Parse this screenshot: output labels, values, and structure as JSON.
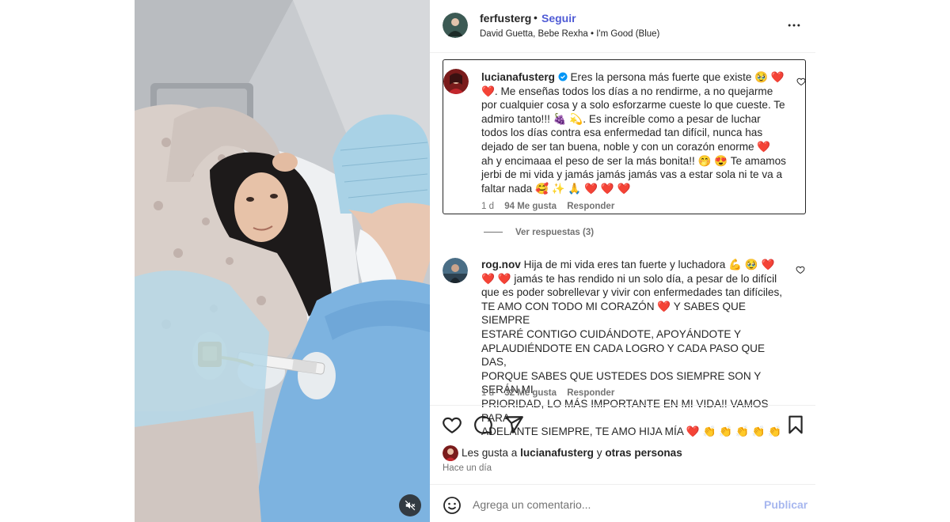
{
  "post": {
    "username": "ferfusterg",
    "follow_label": "Seguir",
    "separator": "•",
    "song": "David Guetta, Bebe Rexha • I'm Good (Blue)",
    "more_icon": "more-horizontal-icon",
    "mute_icon": "volume-muted-icon"
  },
  "comments": [
    {
      "username": "lucianafusterg",
      "verified": true,
      "text": "Eres la persona más fuerte que existe 🥹 ❤️\n❤️. Me enseñas todos los días a no rendirme, a no quejarme\npor cualquier cosa y a solo esforzarme cueste lo que cueste. Te\nadmiro tanto!!! 🍇 💫. Es increíble como a pesar de luchar\ntodos los días contra esa enfermedad tan difícil, nunca has\ndejado de ser tan buena, noble y con un corazón enorme ❤️\nah y encimaaa el peso de ser la más bonita!! 🤭 😍 Te amamos\njerbi de mi vida y jamás jamás jamás vas a estar sola ni te va a\nfaltar nada 🥰 ✨ 🙏 ❤️ ❤️ ❤️",
      "time": "1 d",
      "likes": "94 Me gusta",
      "reply_label": "Responder"
    },
    {
      "username": "rog.nov",
      "verified": false,
      "text": "Hija de mi vida eres tan fuerte y luchadora 💪 🥹 ❤️\n❤️ ❤️ jamás te has rendido ni un solo día, a pesar de lo difícil\nque es poder sobrellevar y vivir con enfermedades tan difíciles,\nTE AMO CON TODO MI CORAZÓN ❤️ Y SABES QUE SIEMPRE\nESTARÉ CONTIGO CUIDÁNDOTE, APOYÁNDOTE Y\nAPLAUDIÉNDOTE EN CADA LOGRO Y CADA PASO QUE DAS,\nPORQUE SABES QUE USTEDES DOS SIEMPRE SON Y SERÁN MI\nPRIORIDAD, LO MÁS IMPORTANTE EN MI VIDA!! VAMOS PARA\nADELANTE SIEMPRE, TE AMO HIJA MÍA ❤️ 👏 👏 👏 👏 👏",
      "time": "1 d",
      "likes": "32 Me gusta",
      "reply_label": "Responder"
    }
  ],
  "view_replies": "Ver respuestas (3)",
  "actions": {
    "like_icon": "heart-icon",
    "comment_icon": "comment-bubble-icon",
    "share_icon": "paper-plane-icon",
    "save_icon": "bookmark-icon"
  },
  "likes": {
    "prefix": "Les gusta a ",
    "user": "lucianafusterg",
    "middle": " y ",
    "others": "otras personas"
  },
  "timestamp": "Hace un día",
  "composer": {
    "placeholder": "Agrega un comentario...",
    "publish_label": "Publicar",
    "emoji_icon": "smiley-face-icon"
  },
  "colors": {
    "link_blue": "#4f5bd5",
    "publish_disabled": "#a7b7ef",
    "muted_text": "#737373",
    "heart_red": "#ff3040"
  }
}
